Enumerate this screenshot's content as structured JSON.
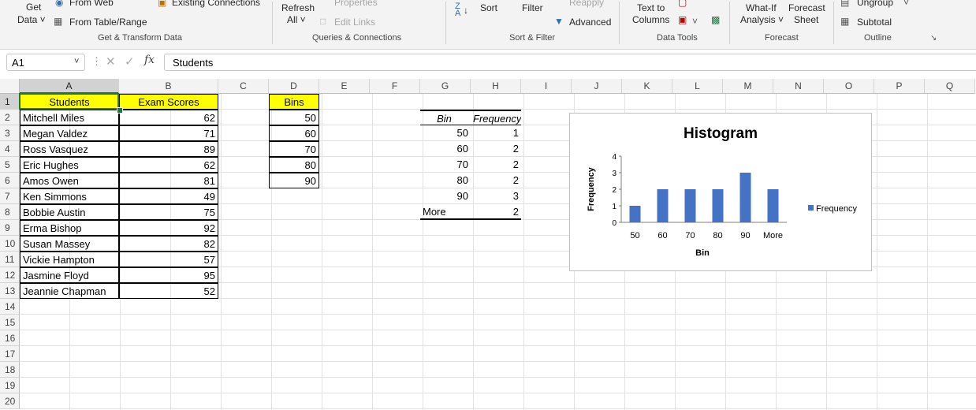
{
  "ribbon": {
    "get_data": [
      "Get",
      "Data ˅"
    ],
    "from_web": "From Web",
    "from_table": "From Table/Range",
    "existing_connections": "Existing Connections",
    "group_get_transform": "Get & Transform Data",
    "refresh_all": [
      "Refresh",
      "All ˅"
    ],
    "properties": "Properties",
    "edit_links": "Edit Links",
    "group_queries": "Queries & Connections",
    "sort": "Sort",
    "filter": "Filter",
    "reapply": "Reapply",
    "advanced": "Advanced",
    "group_sort_filter": "Sort & Filter",
    "text_to_columns": [
      "Text to",
      "Columns"
    ],
    "group_data_tools": "Data Tools",
    "what_if": [
      "What-If",
      "Analysis ˅"
    ],
    "forecast_sheet": [
      "Forecast",
      "Sheet"
    ],
    "group_forecast": "Forecast",
    "ungroup": "Ungroup",
    "subtotal": "Subtotal",
    "group_outline": "Outline"
  },
  "formula_bar": {
    "name_box": "A1",
    "fx": "fx",
    "content": "Students"
  },
  "columns": [
    "A",
    "B",
    "C",
    "D",
    "E",
    "F",
    "G",
    "H",
    "I",
    "J",
    "K",
    "L",
    "M",
    "N",
    "O",
    "P",
    "Q"
  ],
  "rows": [
    "1",
    "2",
    "3",
    "4",
    "5",
    "6",
    "7",
    "8",
    "9",
    "10",
    "11",
    "12",
    "13",
    "14",
    "15",
    "16",
    "17",
    "18",
    "19",
    "20"
  ],
  "table": {
    "headers": [
      "Students",
      "Exam Scores"
    ],
    "rows": [
      [
        "Mitchell Miles",
        "62"
      ],
      [
        "Megan Valdez",
        "71"
      ],
      [
        "Ross Vasquez",
        "89"
      ],
      [
        "Eric Hughes",
        "62"
      ],
      [
        "Amos Owen",
        "81"
      ],
      [
        "Ken Simmons",
        "49"
      ],
      [
        "Bobbie Austin",
        "75"
      ],
      [
        "Erma Bishop",
        "92"
      ],
      [
        "Susan Massey",
        "82"
      ],
      [
        "Vickie Hampton",
        "57"
      ],
      [
        "Jasmine Floyd",
        "95"
      ],
      [
        "Jeannie Chapman",
        "52"
      ]
    ]
  },
  "bins": {
    "header": "Bins",
    "values": [
      "50",
      "60",
      "70",
      "80",
      "90"
    ]
  },
  "freq_table": {
    "headers": [
      "Bin",
      "Frequency"
    ],
    "rows": [
      [
        "50",
        "1"
      ],
      [
        "60",
        "2"
      ],
      [
        "70",
        "2"
      ],
      [
        "80",
        "2"
      ],
      [
        "90",
        "3"
      ],
      [
        "More",
        "2"
      ]
    ]
  },
  "chart_data": {
    "type": "bar",
    "title": "Histogram",
    "categories": [
      "50",
      "60",
      "70",
      "80",
      "90",
      "More"
    ],
    "series": [
      {
        "name": "Frequency",
        "values": [
          1,
          2,
          2,
          2,
          3,
          2
        ],
        "color": "#4472c4"
      }
    ],
    "xlabel": "Bin",
    "ylabel": "Frequency",
    "ylim": [
      0,
      4
    ],
    "yticks": [
      "0",
      "1",
      "2",
      "3",
      "4"
    ],
    "legend": "right",
    "grid": false
  }
}
